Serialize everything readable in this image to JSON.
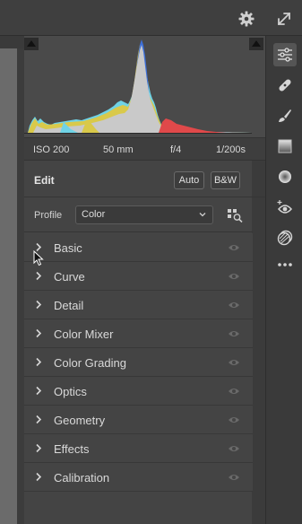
{
  "histogram": {
    "colors": {
      "luminance": "#c9c9c9",
      "red": "#e0494a",
      "cyan": "#6fd3e6",
      "yellow": "#d9c94a",
      "blue": "#3d6fd8"
    }
  },
  "exif": {
    "iso": "ISO 200",
    "focal_length": "50 mm",
    "aperture": "f/4",
    "shutter": "1/200s"
  },
  "edit": {
    "title": "Edit",
    "auto_label": "Auto",
    "bw_label": "B&W"
  },
  "profile": {
    "label": "Profile",
    "selected": "Color"
  },
  "sections": [
    {
      "label": "Basic"
    },
    {
      "label": "Curve"
    },
    {
      "label": "Detail"
    },
    {
      "label": "Color Mixer"
    },
    {
      "label": "Color Grading"
    },
    {
      "label": "Optics"
    },
    {
      "label": "Geometry"
    },
    {
      "label": "Effects"
    },
    {
      "label": "Calibration"
    }
  ],
  "toolbar": {
    "tools": [
      "edit-sliders-icon",
      "healing-icon",
      "brush-icon",
      "linear-gradient-icon",
      "radial-gradient-icon",
      "red-eye-icon",
      "presets-icon",
      "more-icon"
    ]
  }
}
